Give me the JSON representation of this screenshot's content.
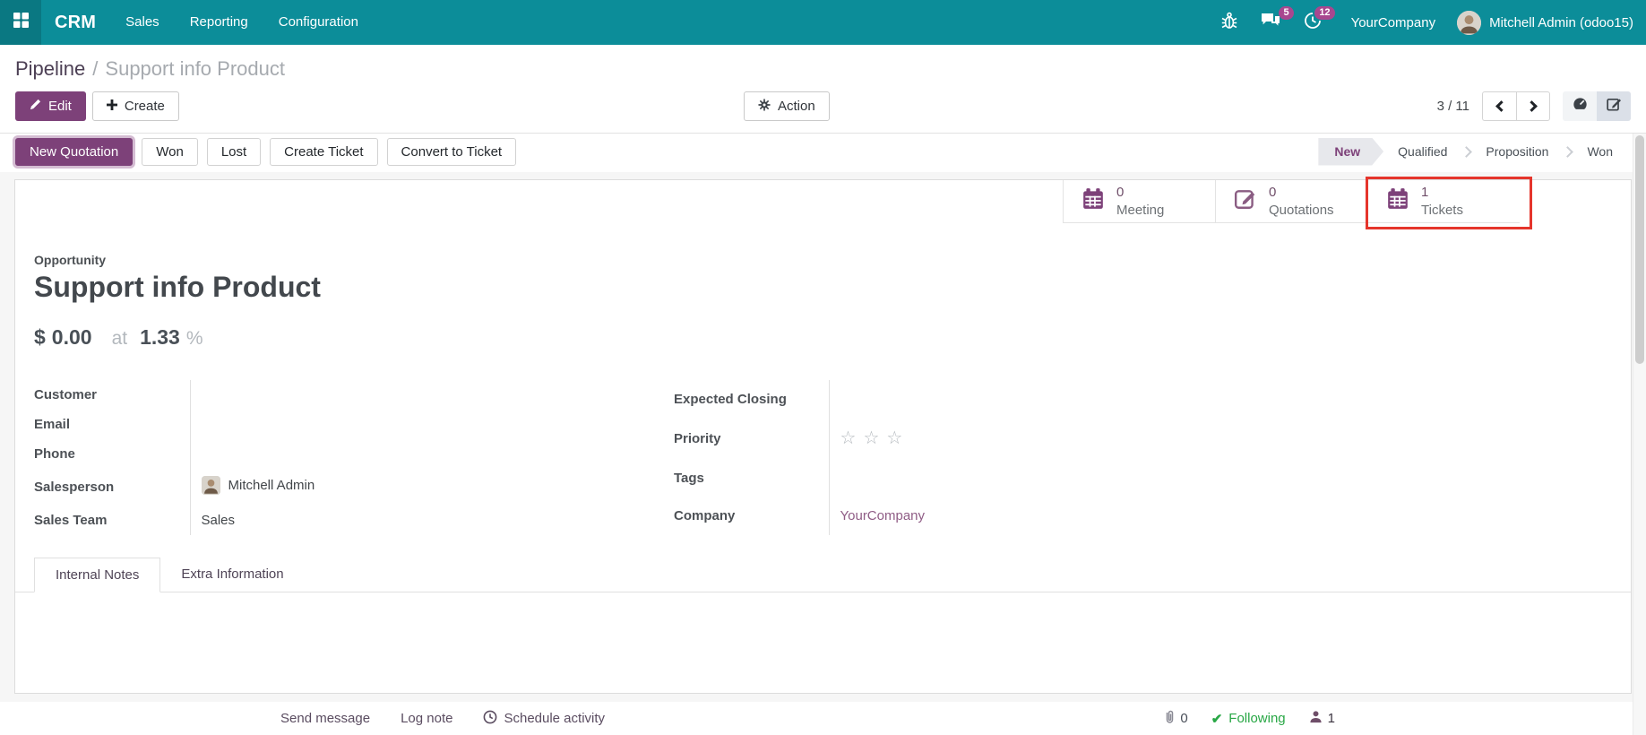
{
  "navbar": {
    "app_name": "CRM",
    "menus": [
      {
        "label": "Sales"
      },
      {
        "label": "Reporting"
      },
      {
        "label": "Configuration"
      }
    ],
    "message_badge": "5",
    "activity_badge": "12",
    "company": "YourCompany",
    "user": "Mitchell Admin (odoo15)"
  },
  "breadcrumb": {
    "parent": "Pipeline",
    "separator": "/",
    "current": "Support info Product"
  },
  "control_panel": {
    "edit_label": "Edit",
    "create_label": "Create",
    "action_label": "Action",
    "pager_value": "3 / 11"
  },
  "statusbar": {
    "buttons": [
      {
        "label": "New Quotation",
        "primary": true
      },
      {
        "label": "Won"
      },
      {
        "label": "Lost"
      },
      {
        "label": "Create Ticket"
      },
      {
        "label": "Convert to Ticket"
      }
    ],
    "stages": [
      {
        "label": "New",
        "active": true
      },
      {
        "label": "Qualified"
      },
      {
        "label": "Proposition"
      },
      {
        "label": "Won"
      }
    ]
  },
  "stat_buttons": [
    {
      "value": "0",
      "label": "Meeting",
      "icon": "calendar-icon"
    },
    {
      "value": "0",
      "label": "Quotations",
      "icon": "edit-note-icon"
    },
    {
      "value": "1",
      "label": "Tickets",
      "icon": "calendar-icon",
      "highlighted": true
    }
  ],
  "form": {
    "record_type_label": "Opportunity",
    "title": "Support info Product",
    "revenue": {
      "currency": "$",
      "amount": "0.00",
      "at_label": "at",
      "probability": "1.33",
      "percent": "%"
    },
    "left_fields": [
      {
        "label": "Customer",
        "value": ""
      },
      {
        "label": "Email",
        "value": ""
      },
      {
        "label": "Phone",
        "value": ""
      },
      {
        "label": "Salesperson",
        "value": "Mitchell Admin",
        "has_avatar": true
      },
      {
        "label": "Sales Team",
        "value": "Sales"
      }
    ],
    "right_fields": [
      {
        "label": "Expected Closing",
        "value": ""
      },
      {
        "label": "Priority",
        "value": "",
        "stars": 3
      },
      {
        "label": "Tags",
        "value": ""
      },
      {
        "label": "Company",
        "value": "YourCompany",
        "link": true
      }
    ],
    "tabs": [
      {
        "label": "Internal Notes",
        "active": true
      },
      {
        "label": "Extra Information"
      }
    ]
  },
  "chatter": {
    "send_message": "Send message",
    "log_note": "Log note",
    "schedule_activity": "Schedule activity",
    "attachments_count": "0",
    "following_label": "Following",
    "followers_count": "1"
  },
  "icons": {
    "star": "☆",
    "check": "✔"
  },
  "colors": {
    "navbar_bg": "#0c8d99",
    "primary_purple": "#7d4179",
    "badge_magenta": "#a8478f",
    "highlight_red": "#e5352c",
    "following_green": "#28a745",
    "link_purple": "#8f5c85"
  }
}
